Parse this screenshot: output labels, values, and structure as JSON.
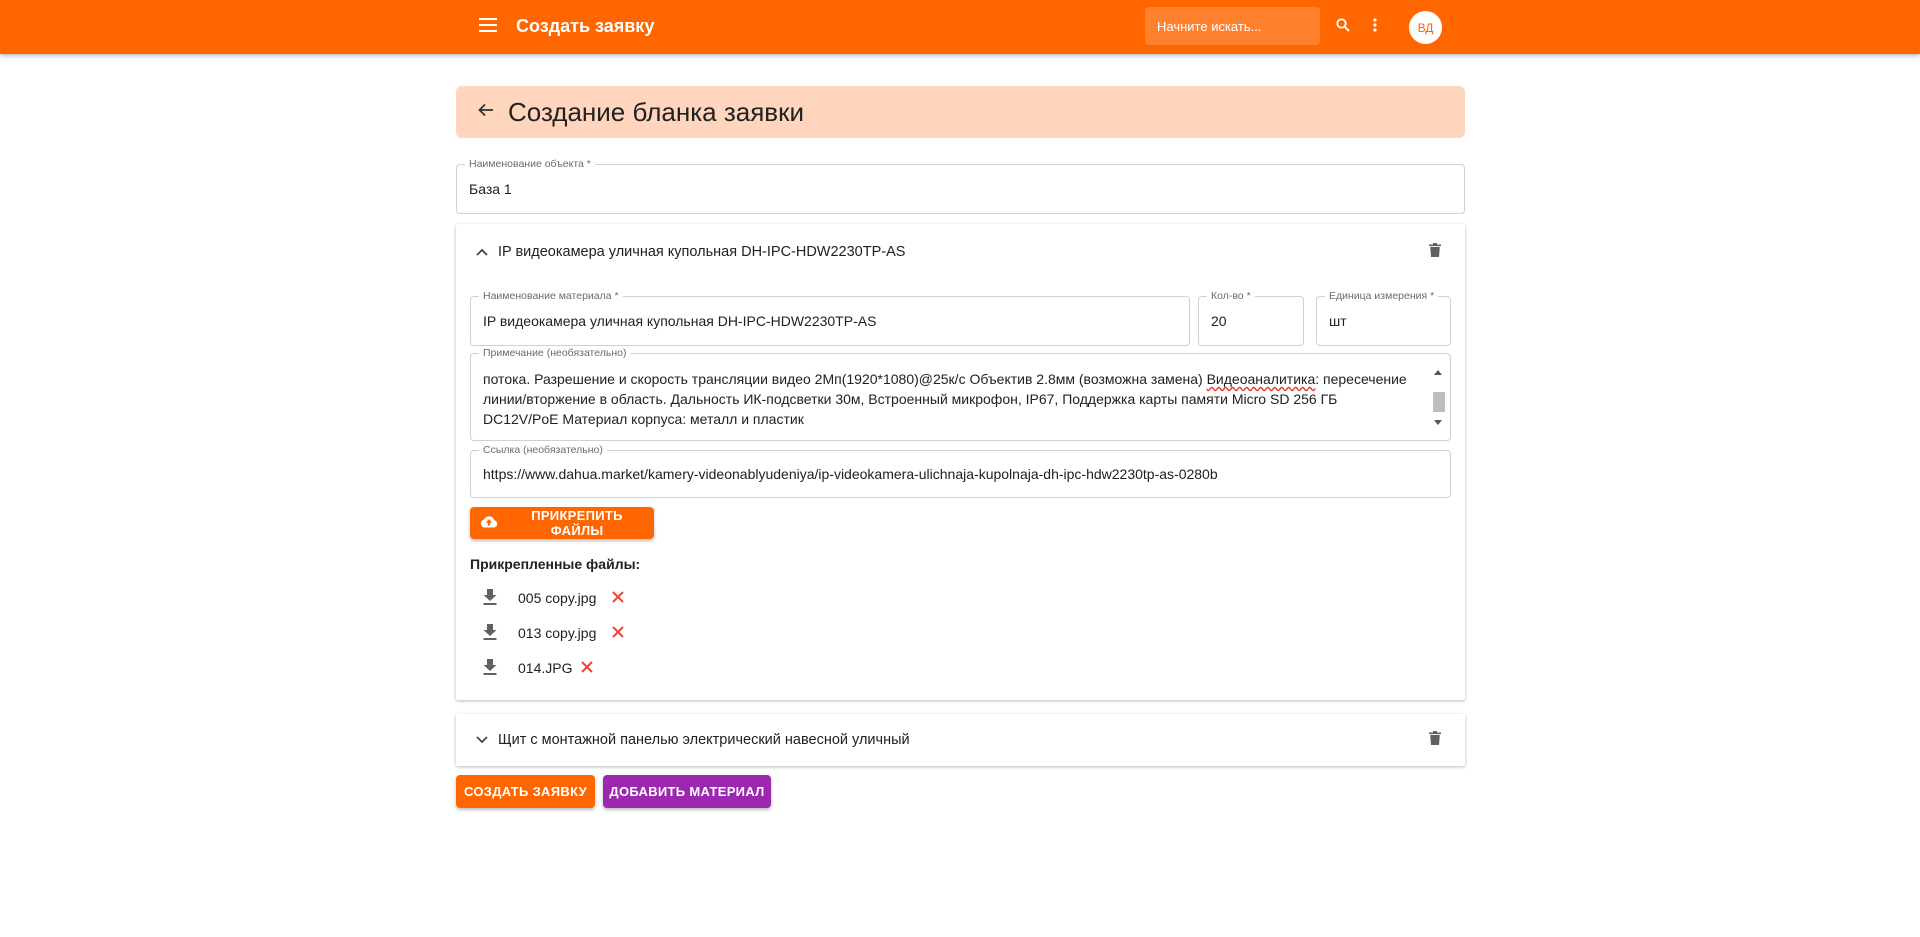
{
  "appbar": {
    "title": "Создать заявку",
    "search_placeholder": "Начните искать...",
    "avatar": "ВД",
    "color": "#ff6600"
  },
  "page": {
    "title": "Создание бланка заявки"
  },
  "object_field": {
    "label": "Наименование объекта *",
    "value": "База 1"
  },
  "materials": [
    {
      "title": "IP видеокамера уличная купольная DH-IPC-HDW2230TP-AS",
      "expanded": true,
      "name_label": "Наименование материала *",
      "name_value": "IP видеокамера уличная купольная DH-IPC-HDW2230TP-AS",
      "qty_label": "Кол-во *",
      "qty_value": "20",
      "unit_label": "Единица измерения *",
      "unit_value": "шт",
      "note_label": "Примечание (необязательно)",
      "note_before": "потока. Разрешение и скорость трансляции видео 2Мп(1920*1080)@25к/с Объектив 2.8мм (возможна замена) ",
      "note_spell": "Видеоаналитика",
      "note_after": ": пересечение линии/вторжение в область. Дальность ИК-подсветки 30м, Встроенный микрофон, IP67, Поддержка карты памяти Micro SD 256 ГБ DC12V/PoE Материал корпуса: металл и пластик",
      "link_label": "Ссылка (необязательно)",
      "link_value": "https://www.dahua.market/kamery-videonablyudeniya/ip-videokamera-ulichnaja-kupolnaja-dh-ipc-hdw2230tp-as-0280b",
      "attach_label": "ПРИКРЕПИТЬ ФАЙЛЫ",
      "attached_title": "Прикрепленные файлы:",
      "files": [
        {
          "name": "005 copy.jpg"
        },
        {
          "name": "013 copy.jpg"
        },
        {
          "name": "014.JPG"
        }
      ]
    },
    {
      "title": "Щит с монтажной панелью электрический навесной уличный",
      "expanded": false
    }
  ],
  "actions": {
    "create_label": "СОЗДАТЬ ЗАЯВКУ",
    "create_color": "#ff6600",
    "add_label": "ДОБАВИТЬ МАТЕРИАЛ",
    "add_color": "#9c27b0"
  },
  "icons": [
    "menu-icon",
    "search-icon",
    "more-vert-icon",
    "arrow-back-icon",
    "chevron-up-icon",
    "chevron-down-icon",
    "delete-icon",
    "cloud-upload-icon",
    "download-icon",
    "close-icon"
  ]
}
